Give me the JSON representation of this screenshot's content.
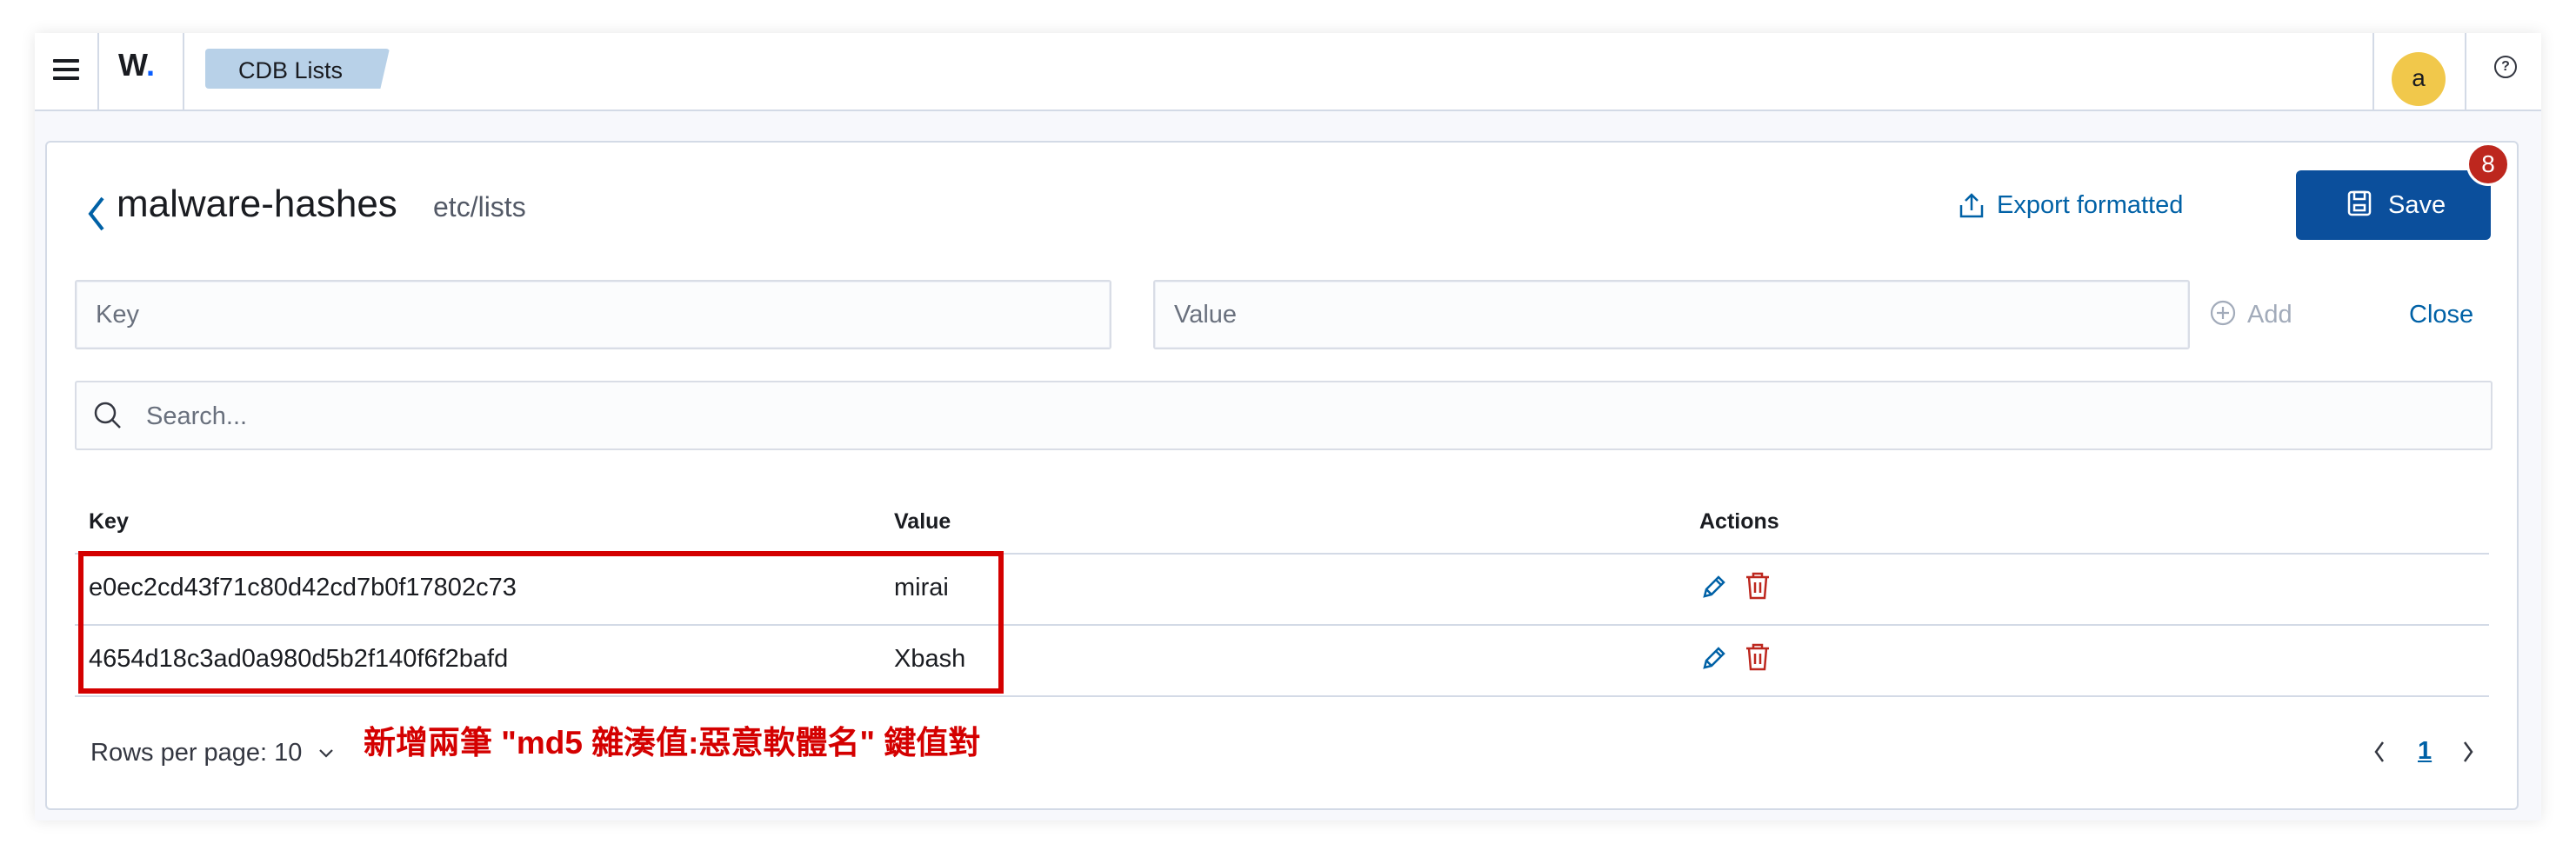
{
  "header": {
    "logo_text": "W",
    "logo_dot": ".",
    "breadcrumb": "CDB Lists",
    "avatar_letter": "a",
    "help_symbol": "?"
  },
  "list": {
    "name": "malware-hashes",
    "path": "etc/lists",
    "export_label": "Export formatted",
    "save_label": "Save",
    "unsaved_badge": "8"
  },
  "form": {
    "key_placeholder": "Key",
    "value_placeholder": "Value",
    "add_label": "Add",
    "close_label": "Close"
  },
  "search": {
    "placeholder": "Search..."
  },
  "table": {
    "columns": [
      "Key",
      "Value",
      "Actions"
    ],
    "rows": [
      {
        "key": "e0ec2cd43f71c80d42cd7b0f17802c73",
        "value": "mirai"
      },
      {
        "key": "4654d18c3ad0a980d5b2f140f6f2bafd",
        "value": "Xbash"
      }
    ]
  },
  "annotation": "新增兩筆 \"md5 雜湊值:惡意軟體名\" 鍵值對",
  "footer": {
    "rows_per_page": "Rows per page: 10",
    "current_page": "1"
  },
  "colors": {
    "primary": "#0b4f9c",
    "link": "#0061a6",
    "danger": "#bd271e",
    "highlight": "#d40000",
    "breadcrumb_bg": "#b8d1e8",
    "avatar_bg": "#f1c84b"
  }
}
